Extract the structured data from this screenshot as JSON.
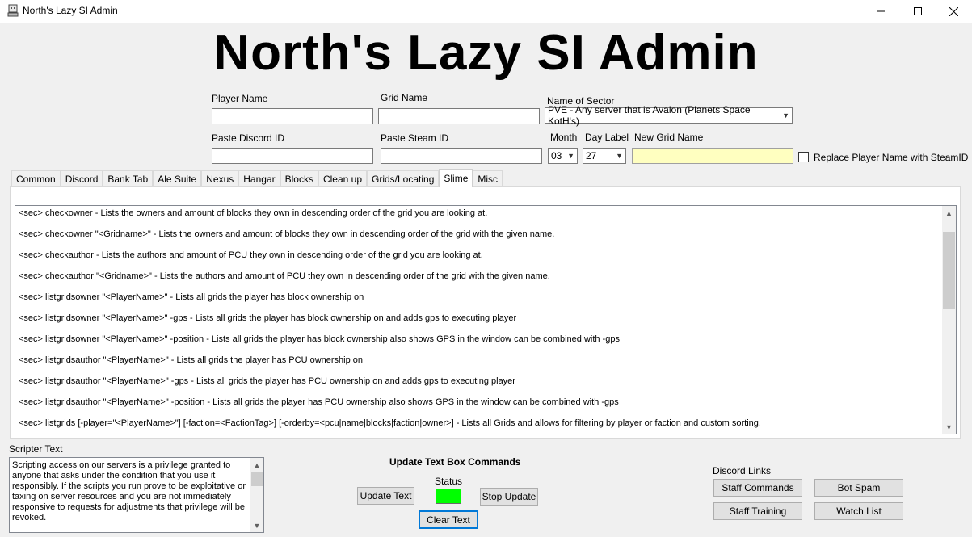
{
  "window": {
    "title": "North's Lazy SI Admin",
    "controls": {
      "minimize": "—",
      "maximize": "☐",
      "close": "✕"
    }
  },
  "header": {
    "title": "North's Lazy SI Admin"
  },
  "form": {
    "player_name_label": "Player Name",
    "player_name_value": "",
    "grid_name_label": "Grid Name",
    "grid_name_value": "",
    "sector_label": "Name of Sector",
    "sector_value": "PVE - Any server that is Avalon (Planets Space KotH's)",
    "discord_id_label": "Paste Discord ID",
    "discord_id_value": "",
    "steam_id_label": "Paste Steam ID",
    "steam_id_value": "",
    "month_label": "Month",
    "month_value": "03",
    "day_label": "Day Label",
    "day_value": "27",
    "new_grid_label": "New Grid Name",
    "new_grid_value": "",
    "new_grid_bg": "#ffffc0",
    "replace_checkbox_label": "Replace Player Name with SteamID",
    "replace_checked": false
  },
  "tabs": [
    {
      "label": "Common",
      "active": false
    },
    {
      "label": "Discord",
      "active": false
    },
    {
      "label": "Bank Tab",
      "active": false
    },
    {
      "label": "Ale Suite",
      "active": false
    },
    {
      "label": "Nexus",
      "active": false
    },
    {
      "label": "Hangar",
      "active": false
    },
    {
      "label": "Blocks",
      "active": false
    },
    {
      "label": "Clean up",
      "active": false
    },
    {
      "label": "Grids/Locating",
      "active": false
    },
    {
      "label": "Slime",
      "active": true
    },
    {
      "label": "Misc",
      "active": false
    }
  ],
  "commands": [
    "<sec> checkowner  -  Lists the owners and amount of blocks they own in descending order of the grid you are looking at.",
    "<sec> checkowner \"<Gridname>\"  -  Lists the owners and amount of blocks they own in descending order of the grid with the given name.",
    "<sec> checkauthor  -  Lists the authors and amount of PCU they own in descending order of the grid you are looking at.",
    "<sec> checkauthor \"<Gridname>\"  -  Lists the authors and amount of PCU they own in descending order of the grid with the given name.",
    "<sec> listgridsowner \"<PlayerName>\"  -  Lists all grids the player has block ownership on",
    "<sec> listgridsowner \"<PlayerName>\" -gps  -  Lists all grids the player has block ownership on and adds gps to executing player",
    "<sec> listgridsowner \"<PlayerName>\" -position  -  Lists all grids the player has block ownership also shows GPS in the window can be combined with -gps",
    "<sec> listgridsauthor \"<PlayerName>\"  -  Lists all grids the player has PCU ownership on",
    "<sec> listgridsauthor \"<PlayerName>\" -gps  -  Lists all grids the player has PCU ownership on and adds gps to executing player",
    "<sec> listgridsauthor \"<PlayerName>\" -position  -  Lists all grids the player has PCU ownership also shows GPS in the window can be combined with -gps",
    "<sec> listgrids [-player=\"<PlayerName>\"] [-faction=<FactionTag>] [-orderby=<pcu|name|blocks|faction|owner>]  -  Lists all Grids and allows for filtering by player or faction and custom sorting."
  ],
  "scripter": {
    "label": "Scripter Text",
    "text": "Scripting access on our servers is a privilege granted to anyone that asks under the condition that you use it responsibly. If the scripts you run prove to be exploitative or taxing on server resources and you are not immediately responsive to requests for adjustments that privilege will be revoked."
  },
  "update_panel": {
    "title": "Update Text Box Commands",
    "status_label": "Status",
    "status_color": "#00ff00",
    "update_button": "Update Text",
    "stop_button": "Stop Update",
    "clear_button": "Clear Text"
  },
  "discord_links": {
    "label": "Discord Links",
    "staff_commands": "Staff Commands",
    "bot_spam": "Bot Spam",
    "staff_training": "Staff Training",
    "watch_list": "Watch List"
  }
}
